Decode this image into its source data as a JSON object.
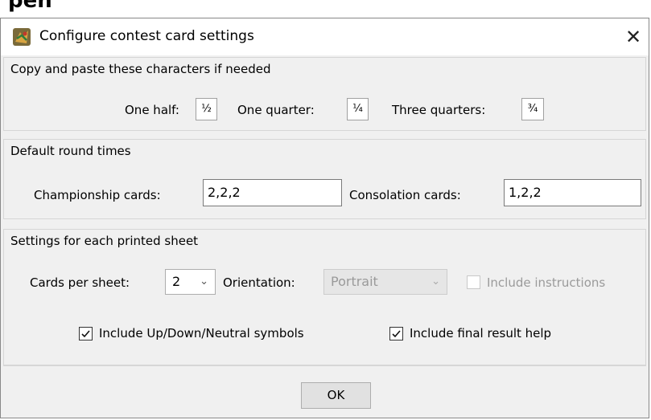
{
  "background_title": "pen",
  "dialog": {
    "title": "Configure contest card settings",
    "close_glyph": "✕",
    "icon": "app-logo-icon"
  },
  "copy_group": {
    "title": "Copy and paste these characters if needed",
    "one_half_label": "One half:",
    "one_half_value": "½",
    "one_quarter_label": "One quarter:",
    "one_quarter_value": "¼",
    "three_quarters_label": "Three quarters:",
    "three_quarters_value": "¾"
  },
  "round_times_group": {
    "title": "Default round times",
    "championship_label": "Championship cards:",
    "championship_value": "2,2,2",
    "consolation_label": "Consolation cards:",
    "consolation_value": "1,2,2"
  },
  "sheet_group": {
    "title": "Settings for each printed sheet",
    "cards_per_sheet_label": "Cards per sheet:",
    "cards_per_sheet_value": "2",
    "orientation_label": "Orientation:",
    "orientation_value": "Portrait",
    "include_instructions_label": "Include instructions",
    "include_instructions_checked": false,
    "include_updown_label": "Include Up/Down/Neutral symbols",
    "include_updown_checked": true,
    "include_final_label": "Include final result help",
    "include_final_checked": true
  },
  "footer": {
    "ok_label": "OK"
  }
}
